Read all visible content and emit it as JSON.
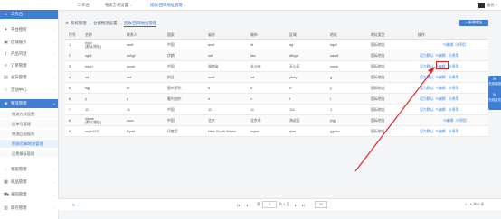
{
  "sidebar": {
    "items": [
      {
        "label": "工作台",
        "icon": "home-icon"
      },
      {
        "label": "平台授权",
        "icon": "key-icon"
      },
      {
        "label": "店铺服务",
        "icon": "store-icon"
      },
      {
        "label": "产品刊登",
        "icon": "upload-icon"
      },
      {
        "label": "订单管理",
        "icon": "order-icon"
      },
      {
        "label": "发货管理",
        "icon": "truck-icon"
      },
      {
        "label": "活动中心",
        "icon": "star-icon"
      },
      {
        "label": "物流管理",
        "icon": "logistics-icon"
      }
    ],
    "subitems": [
      "物流方式设置",
      "运单号管理",
      "物流匹配规则",
      "揽收/回邮地址管理",
      "运费模板管理"
    ],
    "items_bottom": [
      {
        "label": "客服管理",
        "icon": "chat-icon"
      },
      {
        "label": "商品管理",
        "icon": "box-icon"
      },
      {
        "label": "采购管理",
        "icon": "cart-icon"
      },
      {
        "label": "库存管理",
        "icon": "warehouse-icon"
      }
    ]
  },
  "tabs": [
    {
      "label": "工作台"
    },
    {
      "label": "物流方式设置"
    },
    {
      "label": "揽收/回邮地址管理"
    }
  ],
  "user": {
    "label": "操作"
  },
  "breadcrumb": [
    "系统管理",
    "仓储物流设置",
    "揽收/回邮地址管理"
  ],
  "add_button": "+ 新增地址",
  "table": {
    "headers": [
      "序号",
      "名称",
      "联系人",
      "国家",
      "省份",
      "城市",
      "区域",
      "地址",
      "地址类型",
      "操作"
    ],
    "rows": [
      [
        "1",
        "eufd",
        "asdf",
        "中国",
        "asdf",
        "df",
        "dg",
        "dgdf",
        "国际地址"
      ],
      [
        "2",
        "sgdf",
        "dshgf",
        "伊朗",
        "sdf",
        "fda",
        "dfhgd",
        "aasdf",
        "国际地址"
      ],
      [
        "3",
        "hdgh",
        "quwe",
        "中国",
        "湖南省",
        "长沙市",
        "天心区",
        "wwqr",
        "国际地址"
      ],
      [
        "4",
        "sd",
        "asf",
        "约旦",
        "sadf",
        "iut",
        "ytrey",
        "g",
        "国际地址"
      ],
      [
        "5",
        "hgj",
        "hf",
        "直布罗陀",
        "o",
        "o",
        "o",
        "y",
        "国际地址"
      ],
      [
        "6",
        "y",
        "y",
        "塞内加尔",
        "h",
        "x",
        "t",
        "t",
        "国际地址"
      ],
      [
        "7",
        "11",
        "11",
        "中国",
        "11",
        "11",
        "111",
        "1",
        "国际地址"
      ],
      [
        "8",
        "wewe",
        "cscv",
        "中国",
        "北京",
        "北京市",
        "海淀区",
        "jhgj",
        "国际地址"
      ],
      [
        "9",
        "sujie123",
        "Rydd",
        "印度尼",
        "New South Wales",
        "wqea",
        "qwe",
        "gghbv",
        "国际地址"
      ]
    ],
    "default_tag": "(默认地址)",
    "actions": {
      "set_default": "设为默认",
      "edit": "编辑",
      "delete": "停用"
    }
  },
  "pager": {
    "page_label": "第",
    "page": "1",
    "of": "共 1 页",
    "per_page": "20",
    "summary": "1 - 9 共 9 条"
  },
  "float": {
    "label1": "在线客服",
    "label2": "在线留言"
  },
  "colors": {
    "accent": "#3f7fd3",
    "highlight": "#e0262d"
  }
}
